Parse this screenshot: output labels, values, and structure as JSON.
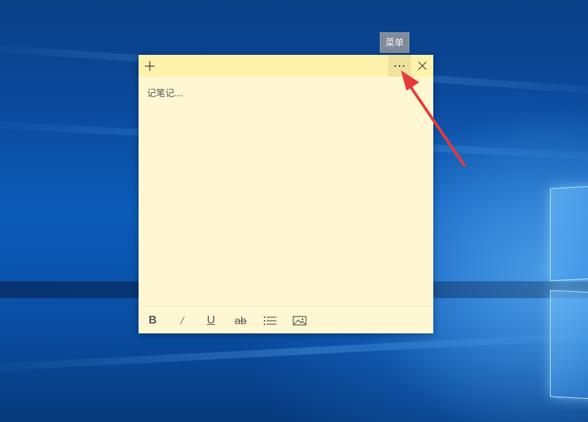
{
  "tooltip": {
    "text": "菜单"
  },
  "note": {
    "body_placeholder": "记笔记...",
    "header": {
      "add_icon": "plus-icon",
      "menu_icon": "ellipsis-icon",
      "close_icon": "close-icon"
    },
    "toolbar": {
      "bold_label": "B",
      "italic_label": "/",
      "underline_label": "U",
      "strike_label": "ab",
      "list_icon": "bullet-list-icon",
      "image_icon": "image-icon"
    },
    "colors": {
      "note_background": "#fff7d1",
      "header_background": "#fff2ab",
      "menu_hover": "#efe29f",
      "arrow": "#e8393a"
    }
  }
}
